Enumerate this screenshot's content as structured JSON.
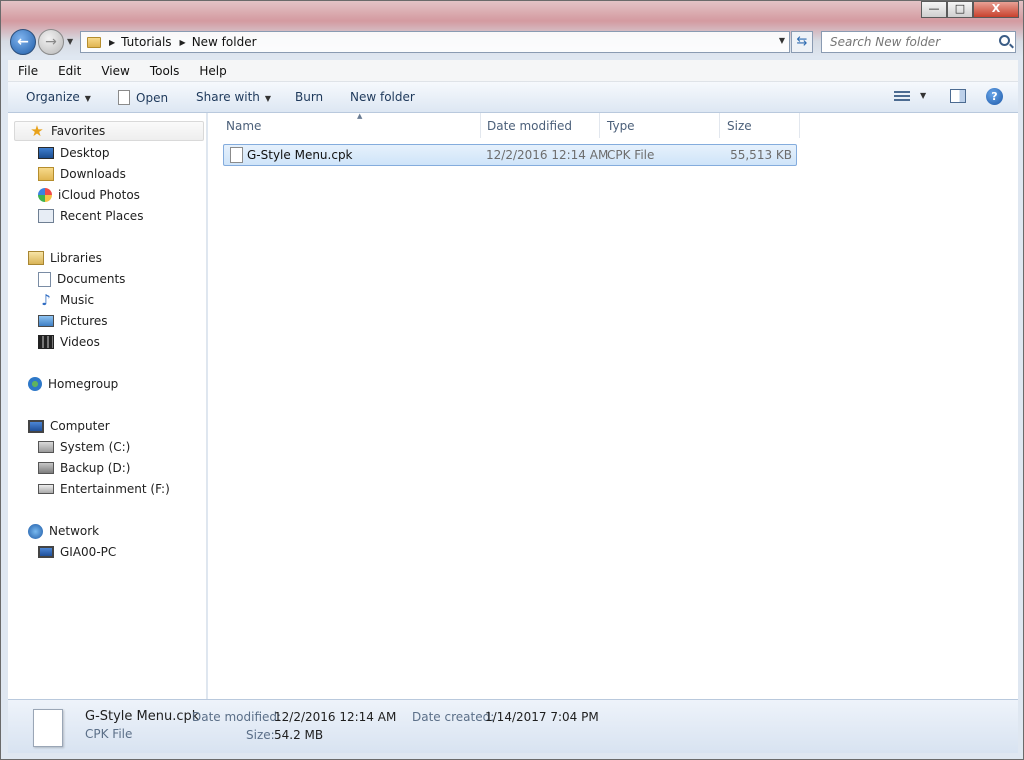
{
  "window": {
    "minimize_glyph": "—",
    "maximize_glyph": "□",
    "close_glyph": "X"
  },
  "address": {
    "back_glyph": "←",
    "forward_glyph": "→",
    "breadcrumbs": [
      "Tutorials",
      "New folder"
    ],
    "refresh_glyph": "⇆"
  },
  "search": {
    "placeholder": "Search New folder"
  },
  "menu": [
    "File",
    "Edit",
    "View",
    "Tools",
    "Help"
  ],
  "toolbar": {
    "organize": "Organize",
    "open": "Open",
    "share_with": "Share with",
    "burn": "Burn",
    "new_folder": "New folder",
    "help_glyph": "?"
  },
  "nav": {
    "favorites": {
      "label": "Favorites",
      "items": [
        "Desktop",
        "Downloads",
        "iCloud Photos",
        "Recent Places"
      ]
    },
    "libraries": {
      "label": "Libraries",
      "items": [
        "Documents",
        "Music",
        "Pictures",
        "Videos"
      ]
    },
    "homegroup": {
      "label": "Homegroup"
    },
    "computer": {
      "label": "Computer",
      "items": [
        "System (C:)",
        "Backup (D:)",
        "Entertainment (F:)"
      ]
    },
    "network": {
      "label": "Network",
      "items": [
        "GIA00-PC"
      ]
    }
  },
  "columns": [
    "Name",
    "Date modified",
    "Type",
    "Size"
  ],
  "files": [
    {
      "name": "G-Style Menu.cpk",
      "date_modified": "12/2/2016 12:14 AM",
      "type": "CPK File",
      "size": "55,513 KB"
    }
  ],
  "details": {
    "filename": "G-Style Menu.cpk",
    "type": "CPK File",
    "date_modified_label": "Date modified:",
    "date_modified": "12/2/2016 12:14 AM",
    "date_created_label": "Date created:",
    "date_created": "1/14/2017 7:04 PM",
    "size_label": "Size:",
    "size": "54.2 MB"
  },
  "colors": {
    "selection_fill": "#cfe4f9",
    "selection_border": "#84acdd",
    "nav_accent": "#1e395b"
  }
}
